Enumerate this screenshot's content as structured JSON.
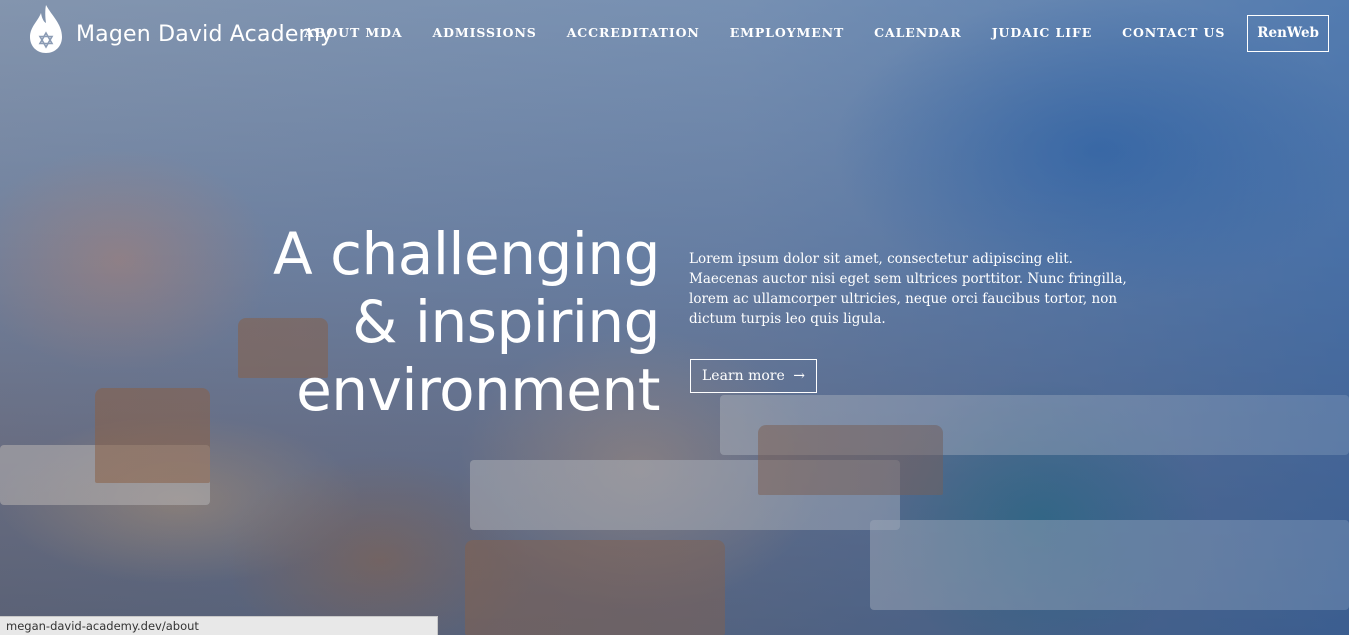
{
  "brand": {
    "name": "Magen David Academy",
    "logo_icon": "flame-star-icon"
  },
  "nav": {
    "items": [
      {
        "label": "ABOUT MDA"
      },
      {
        "label": "ADMISSIONS"
      },
      {
        "label": "ACCREDITATION"
      },
      {
        "label": "EMPLOYMENT"
      },
      {
        "label": "CALENDAR"
      },
      {
        "label": "JUDAIC LIFE"
      },
      {
        "label": "CONTACT US"
      }
    ],
    "portal_button": "RenWeb"
  },
  "hero": {
    "headline_lines": [
      "A challenging",
      "& inspiring",
      "environment"
    ],
    "intro": "Lorem ipsum dolor sit amet, consectetur adipiscing elit. Maecenas auctor nisi eget sem ultrices porttitor. Nunc fringilla, lorem ac ullamcorper ultricies, neque orci faucibus tortor, non dictum turpis leo quis ligula.",
    "cta_label": "Learn more",
    "cta_arrow": "→"
  },
  "status_bar": {
    "url": "megan-david-academy.dev/about"
  },
  "colors": {
    "text": "#ffffff",
    "overlay_blue": "#1f56a0"
  }
}
